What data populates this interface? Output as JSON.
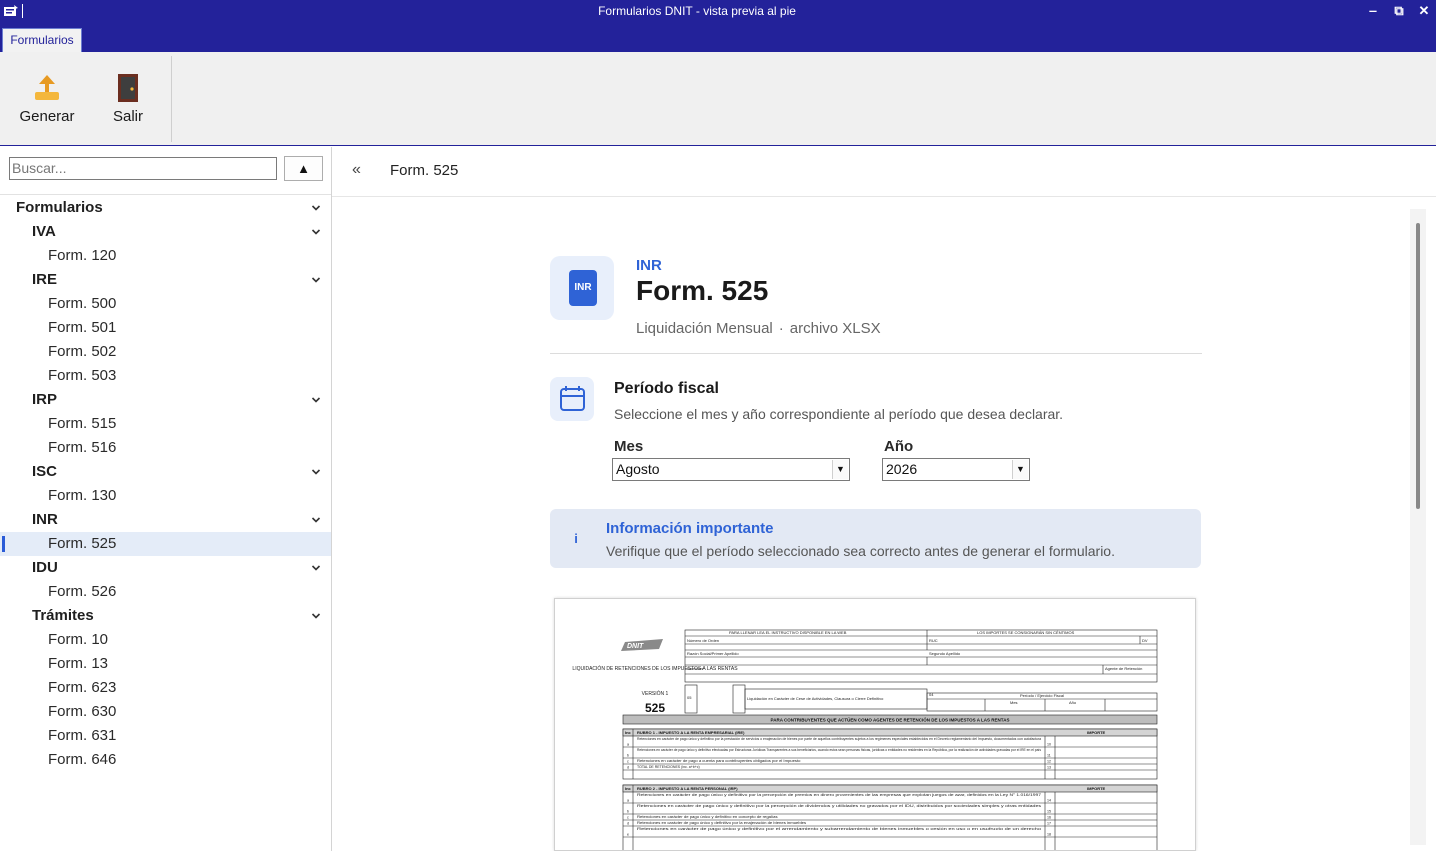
{
  "window": {
    "title": "Formularios DNIT - vista previa al pie",
    "minimize": "‒",
    "restore": "⧉",
    "close": "✕"
  },
  "ribbon": {
    "tab": "Formularios",
    "buttons": [
      {
        "label": "Generar",
        "icon": "upload-icon"
      },
      {
        "label": "Salir",
        "icon": "door-exit-icon"
      }
    ]
  },
  "sidebar": {
    "search": {
      "placeholder": "Buscar...",
      "value": ""
    },
    "search_button": "▲",
    "tree": [
      {
        "label": "Formularios",
        "level": 0
      },
      {
        "label": "IVA",
        "level": 1
      },
      {
        "label": "Form. 120",
        "level": 2
      },
      {
        "label": "IRE",
        "level": 1
      },
      {
        "label": "Form. 500",
        "level": 2
      },
      {
        "label": "Form. 501",
        "level": 2
      },
      {
        "label": "Form. 502",
        "level": 2
      },
      {
        "label": "Form. 503",
        "level": 2
      },
      {
        "label": "IRP",
        "level": 1
      },
      {
        "label": "Form. 515",
        "level": 2
      },
      {
        "label": "Form. 516",
        "level": 2
      },
      {
        "label": "ISC",
        "level": 1
      },
      {
        "label": "Form. 130",
        "level": 2
      },
      {
        "label": "INR",
        "level": 1
      },
      {
        "label": "Form. 525",
        "level": 2,
        "selected": true
      },
      {
        "label": "IDU",
        "level": 1
      },
      {
        "label": "Form. 526",
        "level": 2
      },
      {
        "label": "Trámites",
        "level": 1
      },
      {
        "label": "Form. 10",
        "level": 2
      },
      {
        "label": "Form. 13",
        "level": 2
      },
      {
        "label": "Form. 623",
        "level": 2
      },
      {
        "label": "Form. 630",
        "level": 2
      },
      {
        "label": "Form. 631",
        "level": 2
      },
      {
        "label": "Form. 646",
        "level": 2
      }
    ]
  },
  "main": {
    "breadcrumb": {
      "back": "«",
      "title": "Form. 525"
    },
    "header": {
      "badge": "INR",
      "category": "INR",
      "title": "Form. 525",
      "subtitle": "Liquidación Mensual",
      "separator": "·",
      "format": "archivo XLSX"
    },
    "periodo": {
      "title": "Período fiscal",
      "description": "Seleccione el mes y año correspondiente al período que desea declarar.",
      "mes_label": "Mes",
      "mes_value": "Agosto",
      "anio_label": "Año",
      "anio_value": "2026"
    },
    "info": {
      "icon": "i",
      "title": "Información importante",
      "text": "Verifique que el período seleccionado sea correcto antes de generar el formulario."
    }
  },
  "preview_form": {
    "logo": "DNIT",
    "form_caption": "LIQUIDACIÓN DE RETENCIONES DE LOS IMPUESTOS A LAS RENTAS",
    "version": "VERSIÓN 1",
    "number": "525",
    "header_left": "PARA LLENAR LEA EL INSTRUCTIVO DISPONIBLE EN LA WEB",
    "header_right": "LOS IMPORTES SE CONSIGNARÁN SIN CÉNTIMOS",
    "fields": [
      "Número de Orden",
      "RUC",
      "DV",
      "Razón Social/Primer Apellido",
      "Segundo Apellido",
      "Nombres",
      "Agente de Retención"
    ],
    "code_05": "05",
    "code_04": "04",
    "cese_label": "Liquidación en Carácter de Cese de Actividades, Clausura o Cierre Definitivo",
    "periodo_label": "Período / Ejercicio Fiscal",
    "mes": "Mes",
    "anio": "Año",
    "banner": "PARA CONTRIBUYENTES QUE ACTÚEN COMO AGENTES DE RETENCIÓN DE LOS IMPUESTOS A LAS RENTAS",
    "inc": "Inc",
    "importe": "IMPORTE",
    "rubro1": "RUBRO 1 - IMPUESTO A LA RENTA EMPRESARIAL (IRE)",
    "rubro1_rows": [
      {
        "inc": "a",
        "text": "Retenciones en carácter de pago único y definitivo por la prestación de servicios o enajenación de bienes por parte de aquellos contribuyentes sujetos a los regímenes especiales establecidos en el Decreto reglamentario del Impuesto, documentados con autofactura",
        "code": "10"
      },
      {
        "inc": "b",
        "text": "Retenciones en carácter de pago único y definitivo efectuadas por Estructuras Jurídicas Transparentes a sus beneficiarios, cuando estos sean personas físicas, jurídicas o entidades no residentes en la República, por la realización de actividades gravadas por el IRE en el país",
        "code": "11"
      },
      {
        "inc": "c",
        "text": "Retenciones en carácter de pago a cuenta para contribuyentes obligados por el Impuesto",
        "code": "12"
      },
      {
        "inc": "d",
        "text": "TOTAL DE RETENCIONES (inc. a+b+c)",
        "code": "13"
      }
    ],
    "rubro2": "RUBRO 2 - IMPUESTO A LA RENTA PERSONAL (IRP)",
    "rubro2_rows": [
      {
        "inc": "a",
        "text": "Retenciones en carácter de pago único y definitivo por la percepción de premios en dinero provenientes de las empresas que explotan juegos de azar, definidos en la Ley N° 1.016/1997",
        "code": "14"
      },
      {
        "inc": "b",
        "text": "Retenciones en carácter de pago único y definitivo por la percepción de dividendos y utilidades no gravados por el IDU, distribuidos por sociedades simples y otras entidades",
        "code": "15"
      },
      {
        "inc": "c",
        "text": "Retenciones en carácter de pago único y definitivo en concepto de regalías",
        "code": "16"
      },
      {
        "inc": "d",
        "text": "Retenciones en carácter de pago único y definitivo por la enajenación de bienes inmuebles",
        "code": "17"
      },
      {
        "inc": "e",
        "text": "Retenciones en carácter de pago único y definitivo por el arrendamiento y subarrendamiento de bienes inmuebles o cesión en uso o en usufructo de un derecho",
        "code": "18"
      }
    ]
  }
}
